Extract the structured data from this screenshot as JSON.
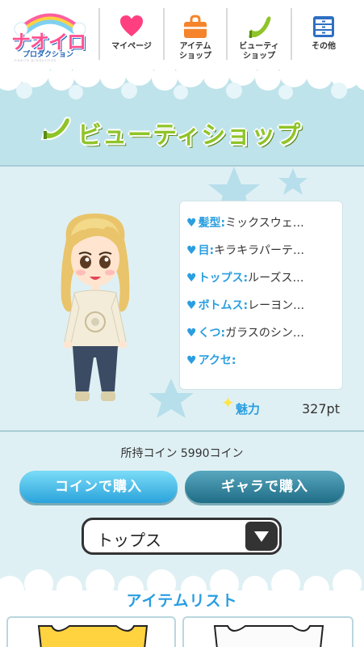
{
  "header": {
    "logo_text": "ナオイロ",
    "logo_subtitle": "プロダクション",
    "logo_tagline": "naoiro production",
    "nav": [
      {
        "label": "マイページ",
        "icon": "heart-icon"
      },
      {
        "label": "アイテム\nショップ",
        "icon": "bag-icon"
      },
      {
        "label": "ビューティ\nショップ",
        "icon": "high-heel-icon"
      },
      {
        "label": "その他",
        "icon": "drawer-icon"
      }
    ]
  },
  "page": {
    "title": "ビューティショップ"
  },
  "avatar": {
    "outfit": [
      {
        "label": "髪型:",
        "value": "ミックスウェ…"
      },
      {
        "label": "目:",
        "value": "キラキラパーテ…"
      },
      {
        "label": "トップス:",
        "value": "ルーズス…"
      },
      {
        "label": "ボトムス:",
        "value": "レーヨン…"
      },
      {
        "label": "くつ:",
        "value": "ガラスのシン…"
      },
      {
        "label": "アクセ:",
        "value": ""
      }
    ],
    "charm_label": "魅力",
    "charm_value": "327pt"
  },
  "wallet": {
    "coin_text": "所持コイン 5990コイン"
  },
  "actions": {
    "buy_with_coin": "コインで購入",
    "buy_with_gallery": "ギャラで購入"
  },
  "filter": {
    "selected": "トップス"
  },
  "item_list": {
    "title": "アイテムリスト"
  },
  "colors": {
    "accent_blue": "#2a9ee0",
    "title_green": "#8fc428",
    "heart_pink": "#ff3f7f",
    "bag_orange": "#f5842a"
  }
}
